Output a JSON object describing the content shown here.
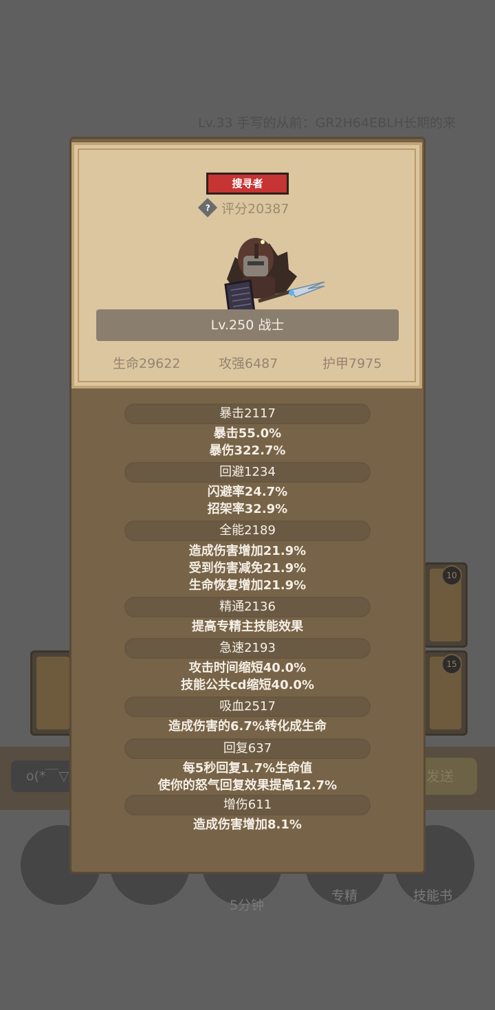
{
  "background": {
    "chat_line": "Lv.33 手写的从前：GR2H64EBLH长期的来",
    "card_badges": [
      "10",
      "15"
    ],
    "chat_input_value": "o(*￣▽",
    "send_button_label": "发送",
    "bottom_nav": [
      {
        "label": ""
      },
      {
        "label": ""
      },
      {
        "label": "5分钟"
      },
      {
        "label": "专精"
      },
      {
        "label": "技能书"
      }
    ]
  },
  "profile": {
    "title_badge": "搜寻者",
    "rating": "评分20387",
    "level_class": "Lv.250 战士",
    "stats": {
      "hp": "生命29622",
      "attack": "攻强6487",
      "armor": "护甲7975"
    }
  },
  "attributes": [
    {
      "header": "暴击2117",
      "lines": [
        "暴击55.0%",
        "暴伤322.7%"
      ]
    },
    {
      "header": "回避1234",
      "lines": [
        "闪避率24.7%",
        "招架率32.9%"
      ]
    },
    {
      "header": "全能2189",
      "lines": [
        "造成伤害增加21.9%",
        "受到伤害减免21.9%",
        "生命恢复增加21.9%"
      ]
    },
    {
      "header": "精通2136",
      "lines": [
        "提高专精主技能效果"
      ]
    },
    {
      "header": "急速2193",
      "lines": [
        "攻击时间缩短40.0%",
        "技能公共cd缩短40.0%"
      ]
    },
    {
      "header": "吸血2517",
      "lines": [
        "造成伤害的6.7%转化成生命"
      ]
    },
    {
      "header": "回复637",
      "lines": [
        "每5秒回复1.7%生命值",
        "使你的怒气回复效果提高12.7%"
      ]
    },
    {
      "header": "增伤611",
      "lines": [
        "造成伤害增加8.1%"
      ]
    }
  ]
}
